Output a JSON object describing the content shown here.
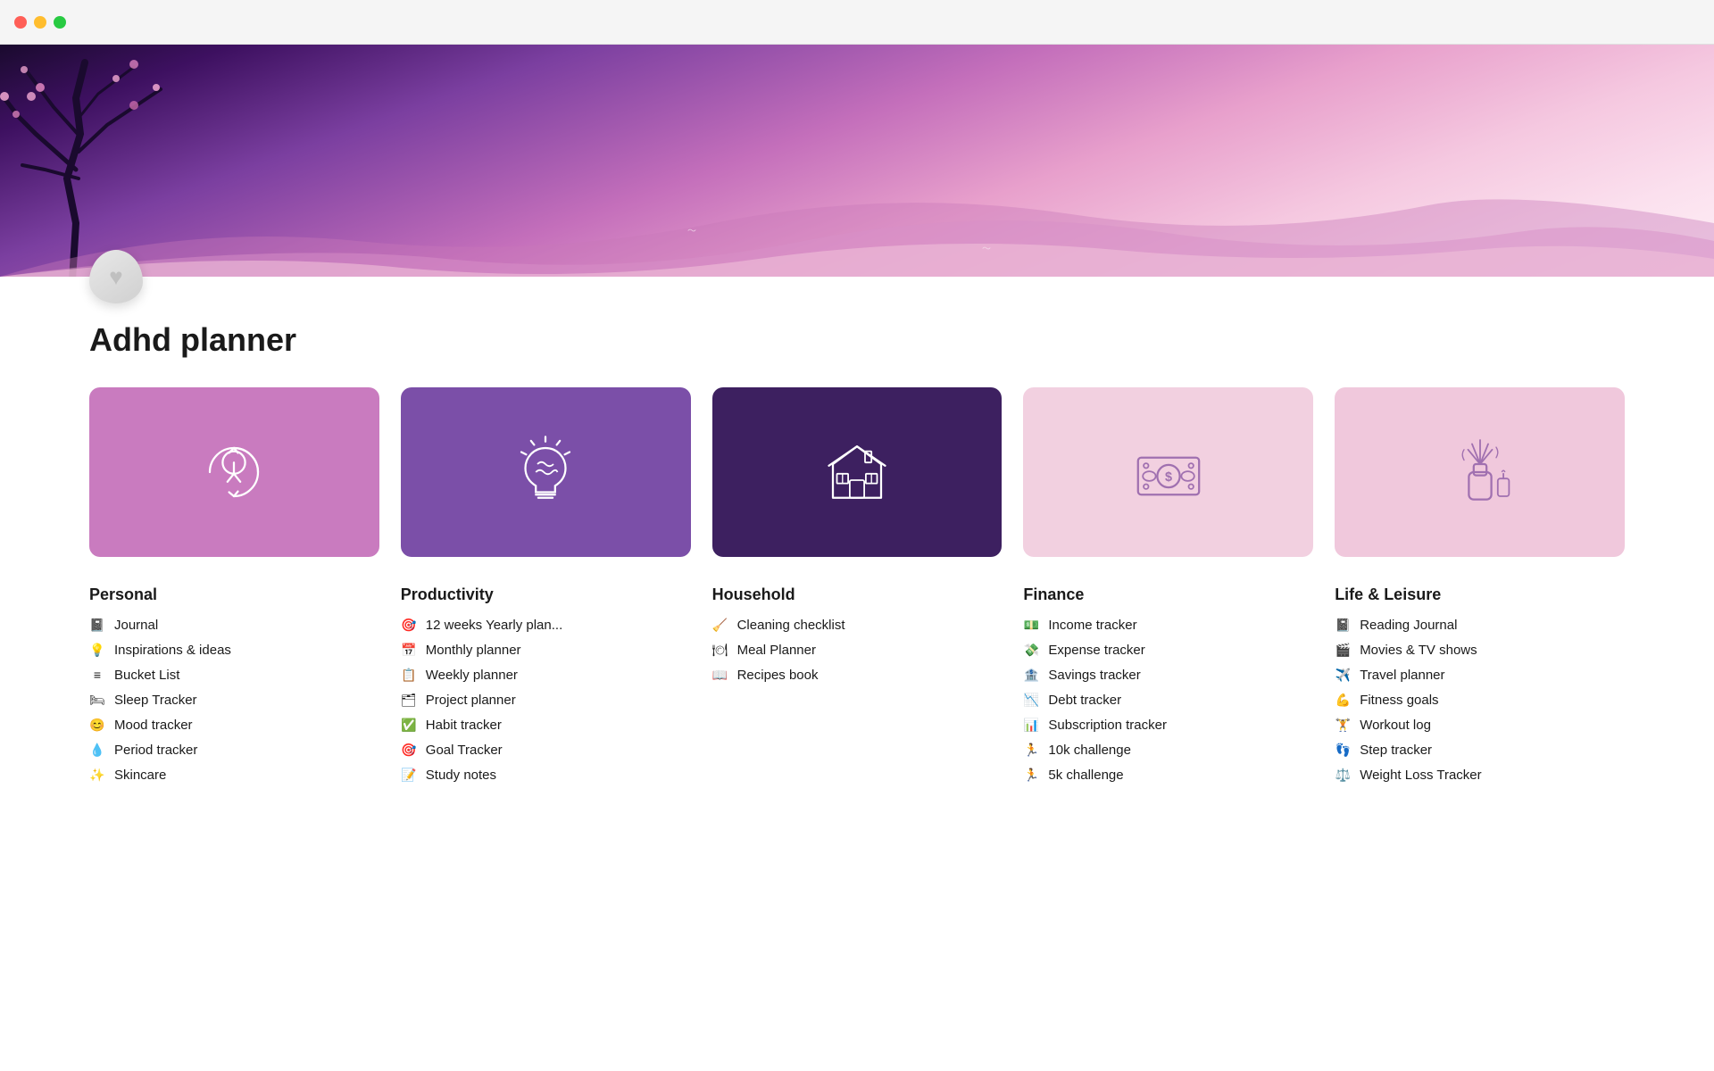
{
  "window": {
    "traffic_lights": [
      "red",
      "yellow",
      "green"
    ]
  },
  "page_title": "Adhd planner",
  "banner": {
    "alt": "Cherry blossom landscape"
  },
  "heart": "♥",
  "columns": [
    {
      "id": "personal",
      "title": "Personal",
      "card_color": "card-personal",
      "items": [
        {
          "icon": "📓",
          "label": "Journal"
        },
        {
          "icon": "💡",
          "label": "Inspirations & ideas"
        },
        {
          "icon": "≡",
          "label": "Bucket List"
        },
        {
          "icon": "🛏",
          "label": "Sleep Tracker"
        },
        {
          "icon": "😊",
          "label": "Mood tracker"
        },
        {
          "icon": "💧",
          "label": "Period tracker"
        },
        {
          "icon": "✨",
          "label": "Skincare"
        }
      ]
    },
    {
      "id": "productivity",
      "title": "Productivity",
      "card_color": "card-productivity",
      "items": [
        {
          "icon": "🎯",
          "label": "12 weeks Yearly plan..."
        },
        {
          "icon": "📅",
          "label": "Monthly planner"
        },
        {
          "icon": "📋",
          "label": "Weekly planner"
        },
        {
          "icon": "🗂",
          "label": "Project planner"
        },
        {
          "icon": "✅",
          "label": "Habit tracker"
        },
        {
          "icon": "🎯",
          "label": "Goal Tracker"
        },
        {
          "icon": "📝",
          "label": "Study notes"
        }
      ]
    },
    {
      "id": "household",
      "title": "Household",
      "card_color": "card-household",
      "items": [
        {
          "icon": "🧹",
          "label": "Cleaning checklist"
        },
        {
          "icon": "🍽",
          "label": "Meal Planner"
        },
        {
          "icon": "📖",
          "label": "Recipes book"
        }
      ]
    },
    {
      "id": "finance",
      "title": "Finance",
      "card_color": "card-finance",
      "items": [
        {
          "icon": "💵",
          "label": "Income tracker"
        },
        {
          "icon": "💸",
          "label": "Expense tracker"
        },
        {
          "icon": "🏦",
          "label": "Savings tracker"
        },
        {
          "icon": "📉",
          "label": "Debt tracker"
        },
        {
          "icon": "📊",
          "label": "Subscription tracker"
        },
        {
          "icon": "🏃",
          "label": "10k challenge"
        },
        {
          "icon": "🏃",
          "label": "5k challenge"
        }
      ]
    },
    {
      "id": "leisure",
      "title": "Life & Leisure",
      "card_color": "card-leisure",
      "items": [
        {
          "icon": "📓",
          "label": "Reading Journal"
        },
        {
          "icon": "🎬",
          "label": "Movies & TV shows"
        },
        {
          "icon": "✈️",
          "label": "Travel planner"
        },
        {
          "icon": "💪",
          "label": "Fitness goals"
        },
        {
          "icon": "🏋️",
          "label": "Workout log"
        },
        {
          "icon": "👣",
          "label": "Step tracker"
        },
        {
          "icon": "⚖️",
          "label": "Weight Loss Tracker"
        }
      ]
    }
  ]
}
